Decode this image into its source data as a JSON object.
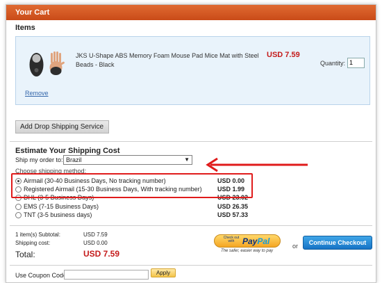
{
  "cart": {
    "header": "Your Cart",
    "items_title": "Items"
  },
  "item": {
    "title": "JKS U-Shape ABS Memory Foam Mouse Pad Mice Mat with Steel Beads - Black",
    "price": "USD 7.59",
    "quantity_label": "Quantity:",
    "quantity_value": "1",
    "remove_label": "Remove"
  },
  "dropship": {
    "label": "Add Drop Shipping Service"
  },
  "shipping": {
    "title": "Estimate Your Shipping Cost",
    "ship_to_label": "Ship my order to:",
    "country": "Brazil",
    "choose_label": "Choose shipping method:",
    "methods": [
      {
        "name": "Airmail (30-40 Business Days, No tracking number)",
        "price": "USD 0.00",
        "selected": true
      },
      {
        "name": "Registered Airmail (15-30 Business Days, With tracking number)",
        "price": "USD 1.99",
        "selected": false
      },
      {
        "name": "DHL (3-5 Business Days)",
        "price": "USD 23.02",
        "selected": false
      },
      {
        "name": "EMS (7-15 Business Days)",
        "price": "USD 26.35",
        "selected": false
      },
      {
        "name": "TNT (3-5 business days)",
        "price": "USD 57.33",
        "selected": false
      }
    ]
  },
  "summary": {
    "subtotal_label": "1 item(s) Subtotal:",
    "subtotal_value": "USD 7.59",
    "shipping_label": "Shipping cost:",
    "shipping_value": "USD 0.00",
    "total_label": "Total:",
    "total_value": "USD 7.59"
  },
  "paypal": {
    "small_text": "Check out with",
    "logo_pay": "Pay",
    "logo_pal": "Pal",
    "tagline": "The safer, easier way to pay"
  },
  "or_text": "or",
  "checkout": {
    "label": "Continue Checkout"
  },
  "coupon": {
    "label": "Use Coupon Code:",
    "apply_label": "Apply",
    "value": ""
  },
  "colors": {
    "header": "#d4592a",
    "price": "#c41a1a",
    "annotation": "#e01b1b",
    "checkout": "#1f86d6"
  },
  "annotation": {
    "highlight": "red rectangle around Airmail and Registered Airmail options",
    "arrow": "red arrow pointing to country selector"
  }
}
